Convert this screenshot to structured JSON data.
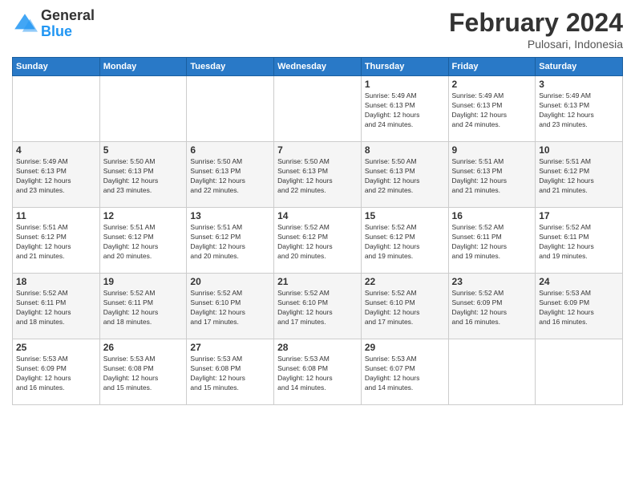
{
  "logo": {
    "general": "General",
    "blue": "Blue"
  },
  "title": "February 2024",
  "subtitle": "Pulosari, Indonesia",
  "days_header": [
    "Sunday",
    "Monday",
    "Tuesday",
    "Wednesday",
    "Thursday",
    "Friday",
    "Saturday"
  ],
  "weeks": [
    [
      {
        "day": "",
        "info": ""
      },
      {
        "day": "",
        "info": ""
      },
      {
        "day": "",
        "info": ""
      },
      {
        "day": "",
        "info": ""
      },
      {
        "day": "1",
        "info": "Sunrise: 5:49 AM\nSunset: 6:13 PM\nDaylight: 12 hours\nand 24 minutes."
      },
      {
        "day": "2",
        "info": "Sunrise: 5:49 AM\nSunset: 6:13 PM\nDaylight: 12 hours\nand 24 minutes."
      },
      {
        "day": "3",
        "info": "Sunrise: 5:49 AM\nSunset: 6:13 PM\nDaylight: 12 hours\nand 23 minutes."
      }
    ],
    [
      {
        "day": "4",
        "info": "Sunrise: 5:49 AM\nSunset: 6:13 PM\nDaylight: 12 hours\nand 23 minutes."
      },
      {
        "day": "5",
        "info": "Sunrise: 5:50 AM\nSunset: 6:13 PM\nDaylight: 12 hours\nand 23 minutes."
      },
      {
        "day": "6",
        "info": "Sunrise: 5:50 AM\nSunset: 6:13 PM\nDaylight: 12 hours\nand 22 minutes."
      },
      {
        "day": "7",
        "info": "Sunrise: 5:50 AM\nSunset: 6:13 PM\nDaylight: 12 hours\nand 22 minutes."
      },
      {
        "day": "8",
        "info": "Sunrise: 5:50 AM\nSunset: 6:13 PM\nDaylight: 12 hours\nand 22 minutes."
      },
      {
        "day": "9",
        "info": "Sunrise: 5:51 AM\nSunset: 6:13 PM\nDaylight: 12 hours\nand 21 minutes."
      },
      {
        "day": "10",
        "info": "Sunrise: 5:51 AM\nSunset: 6:12 PM\nDaylight: 12 hours\nand 21 minutes."
      }
    ],
    [
      {
        "day": "11",
        "info": "Sunrise: 5:51 AM\nSunset: 6:12 PM\nDaylight: 12 hours\nand 21 minutes."
      },
      {
        "day": "12",
        "info": "Sunrise: 5:51 AM\nSunset: 6:12 PM\nDaylight: 12 hours\nand 20 minutes."
      },
      {
        "day": "13",
        "info": "Sunrise: 5:51 AM\nSunset: 6:12 PM\nDaylight: 12 hours\nand 20 minutes."
      },
      {
        "day": "14",
        "info": "Sunrise: 5:52 AM\nSunset: 6:12 PM\nDaylight: 12 hours\nand 20 minutes."
      },
      {
        "day": "15",
        "info": "Sunrise: 5:52 AM\nSunset: 6:12 PM\nDaylight: 12 hours\nand 19 minutes."
      },
      {
        "day": "16",
        "info": "Sunrise: 5:52 AM\nSunset: 6:11 PM\nDaylight: 12 hours\nand 19 minutes."
      },
      {
        "day": "17",
        "info": "Sunrise: 5:52 AM\nSunset: 6:11 PM\nDaylight: 12 hours\nand 19 minutes."
      }
    ],
    [
      {
        "day": "18",
        "info": "Sunrise: 5:52 AM\nSunset: 6:11 PM\nDaylight: 12 hours\nand 18 minutes."
      },
      {
        "day": "19",
        "info": "Sunrise: 5:52 AM\nSunset: 6:11 PM\nDaylight: 12 hours\nand 18 minutes."
      },
      {
        "day": "20",
        "info": "Sunrise: 5:52 AM\nSunset: 6:10 PM\nDaylight: 12 hours\nand 17 minutes."
      },
      {
        "day": "21",
        "info": "Sunrise: 5:52 AM\nSunset: 6:10 PM\nDaylight: 12 hours\nand 17 minutes."
      },
      {
        "day": "22",
        "info": "Sunrise: 5:52 AM\nSunset: 6:10 PM\nDaylight: 12 hours\nand 17 minutes."
      },
      {
        "day": "23",
        "info": "Sunrise: 5:52 AM\nSunset: 6:09 PM\nDaylight: 12 hours\nand 16 minutes."
      },
      {
        "day": "24",
        "info": "Sunrise: 5:53 AM\nSunset: 6:09 PM\nDaylight: 12 hours\nand 16 minutes."
      }
    ],
    [
      {
        "day": "25",
        "info": "Sunrise: 5:53 AM\nSunset: 6:09 PM\nDaylight: 12 hours\nand 16 minutes."
      },
      {
        "day": "26",
        "info": "Sunrise: 5:53 AM\nSunset: 6:08 PM\nDaylight: 12 hours\nand 15 minutes."
      },
      {
        "day": "27",
        "info": "Sunrise: 5:53 AM\nSunset: 6:08 PM\nDaylight: 12 hours\nand 15 minutes."
      },
      {
        "day": "28",
        "info": "Sunrise: 5:53 AM\nSunset: 6:08 PM\nDaylight: 12 hours\nand 14 minutes."
      },
      {
        "day": "29",
        "info": "Sunrise: 5:53 AM\nSunset: 6:07 PM\nDaylight: 12 hours\nand 14 minutes."
      },
      {
        "day": "",
        "info": ""
      },
      {
        "day": "",
        "info": ""
      }
    ]
  ]
}
